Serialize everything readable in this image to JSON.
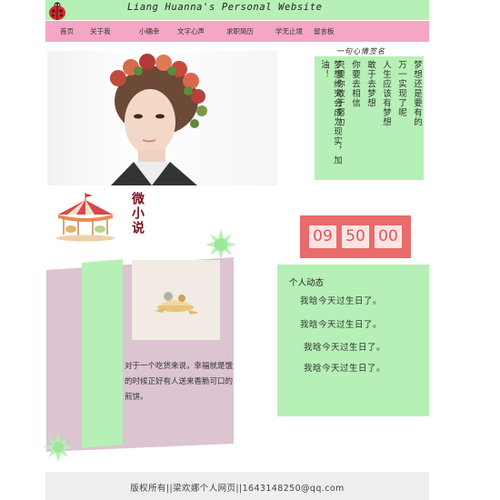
{
  "header": {
    "title": "Liang Huanna's Personal Website",
    "logo_icon": "ladybug-icon"
  },
  "nav": {
    "items": [
      "首页",
      "关于我",
      "小确幸",
      "文字心声",
      "求职简历",
      "学无止境",
      "留言板"
    ]
  },
  "poem": {
    "title": "一句心情签名",
    "lines": [
      "梦想还是要有的",
      "万一实现了呢",
      "人生应该有梦想",
      "敢于去梦想",
      "你要去相信",
      "只要你敢于努力",
      "梦想终究会成为现实，加油！"
    ]
  },
  "micro_novel": {
    "title": "微小说",
    "icon": "carousel-icon"
  },
  "timer": {
    "hours": "09",
    "minutes": "50",
    "seconds": "00"
  },
  "story": {
    "text": "对于一个吃货来说，幸福就是饿的时候正好有人送来香脆可口的煎饼。"
  },
  "activity": {
    "title": "个人动态",
    "items": [
      "我晗今天过生日了。",
      "我晗今天过生日了。",
      "我晗今天过生日了。",
      "我晗今天过生日了。"
    ]
  },
  "footer": {
    "text": "版权所有||梁欢娜个人网页||1643148250@qq.com"
  },
  "colors": {
    "green": "#b6f0b6",
    "pink_nav": "#f4a6c4",
    "timer_red": "#e96b6b",
    "card_mauve": "#dcc4d1"
  }
}
